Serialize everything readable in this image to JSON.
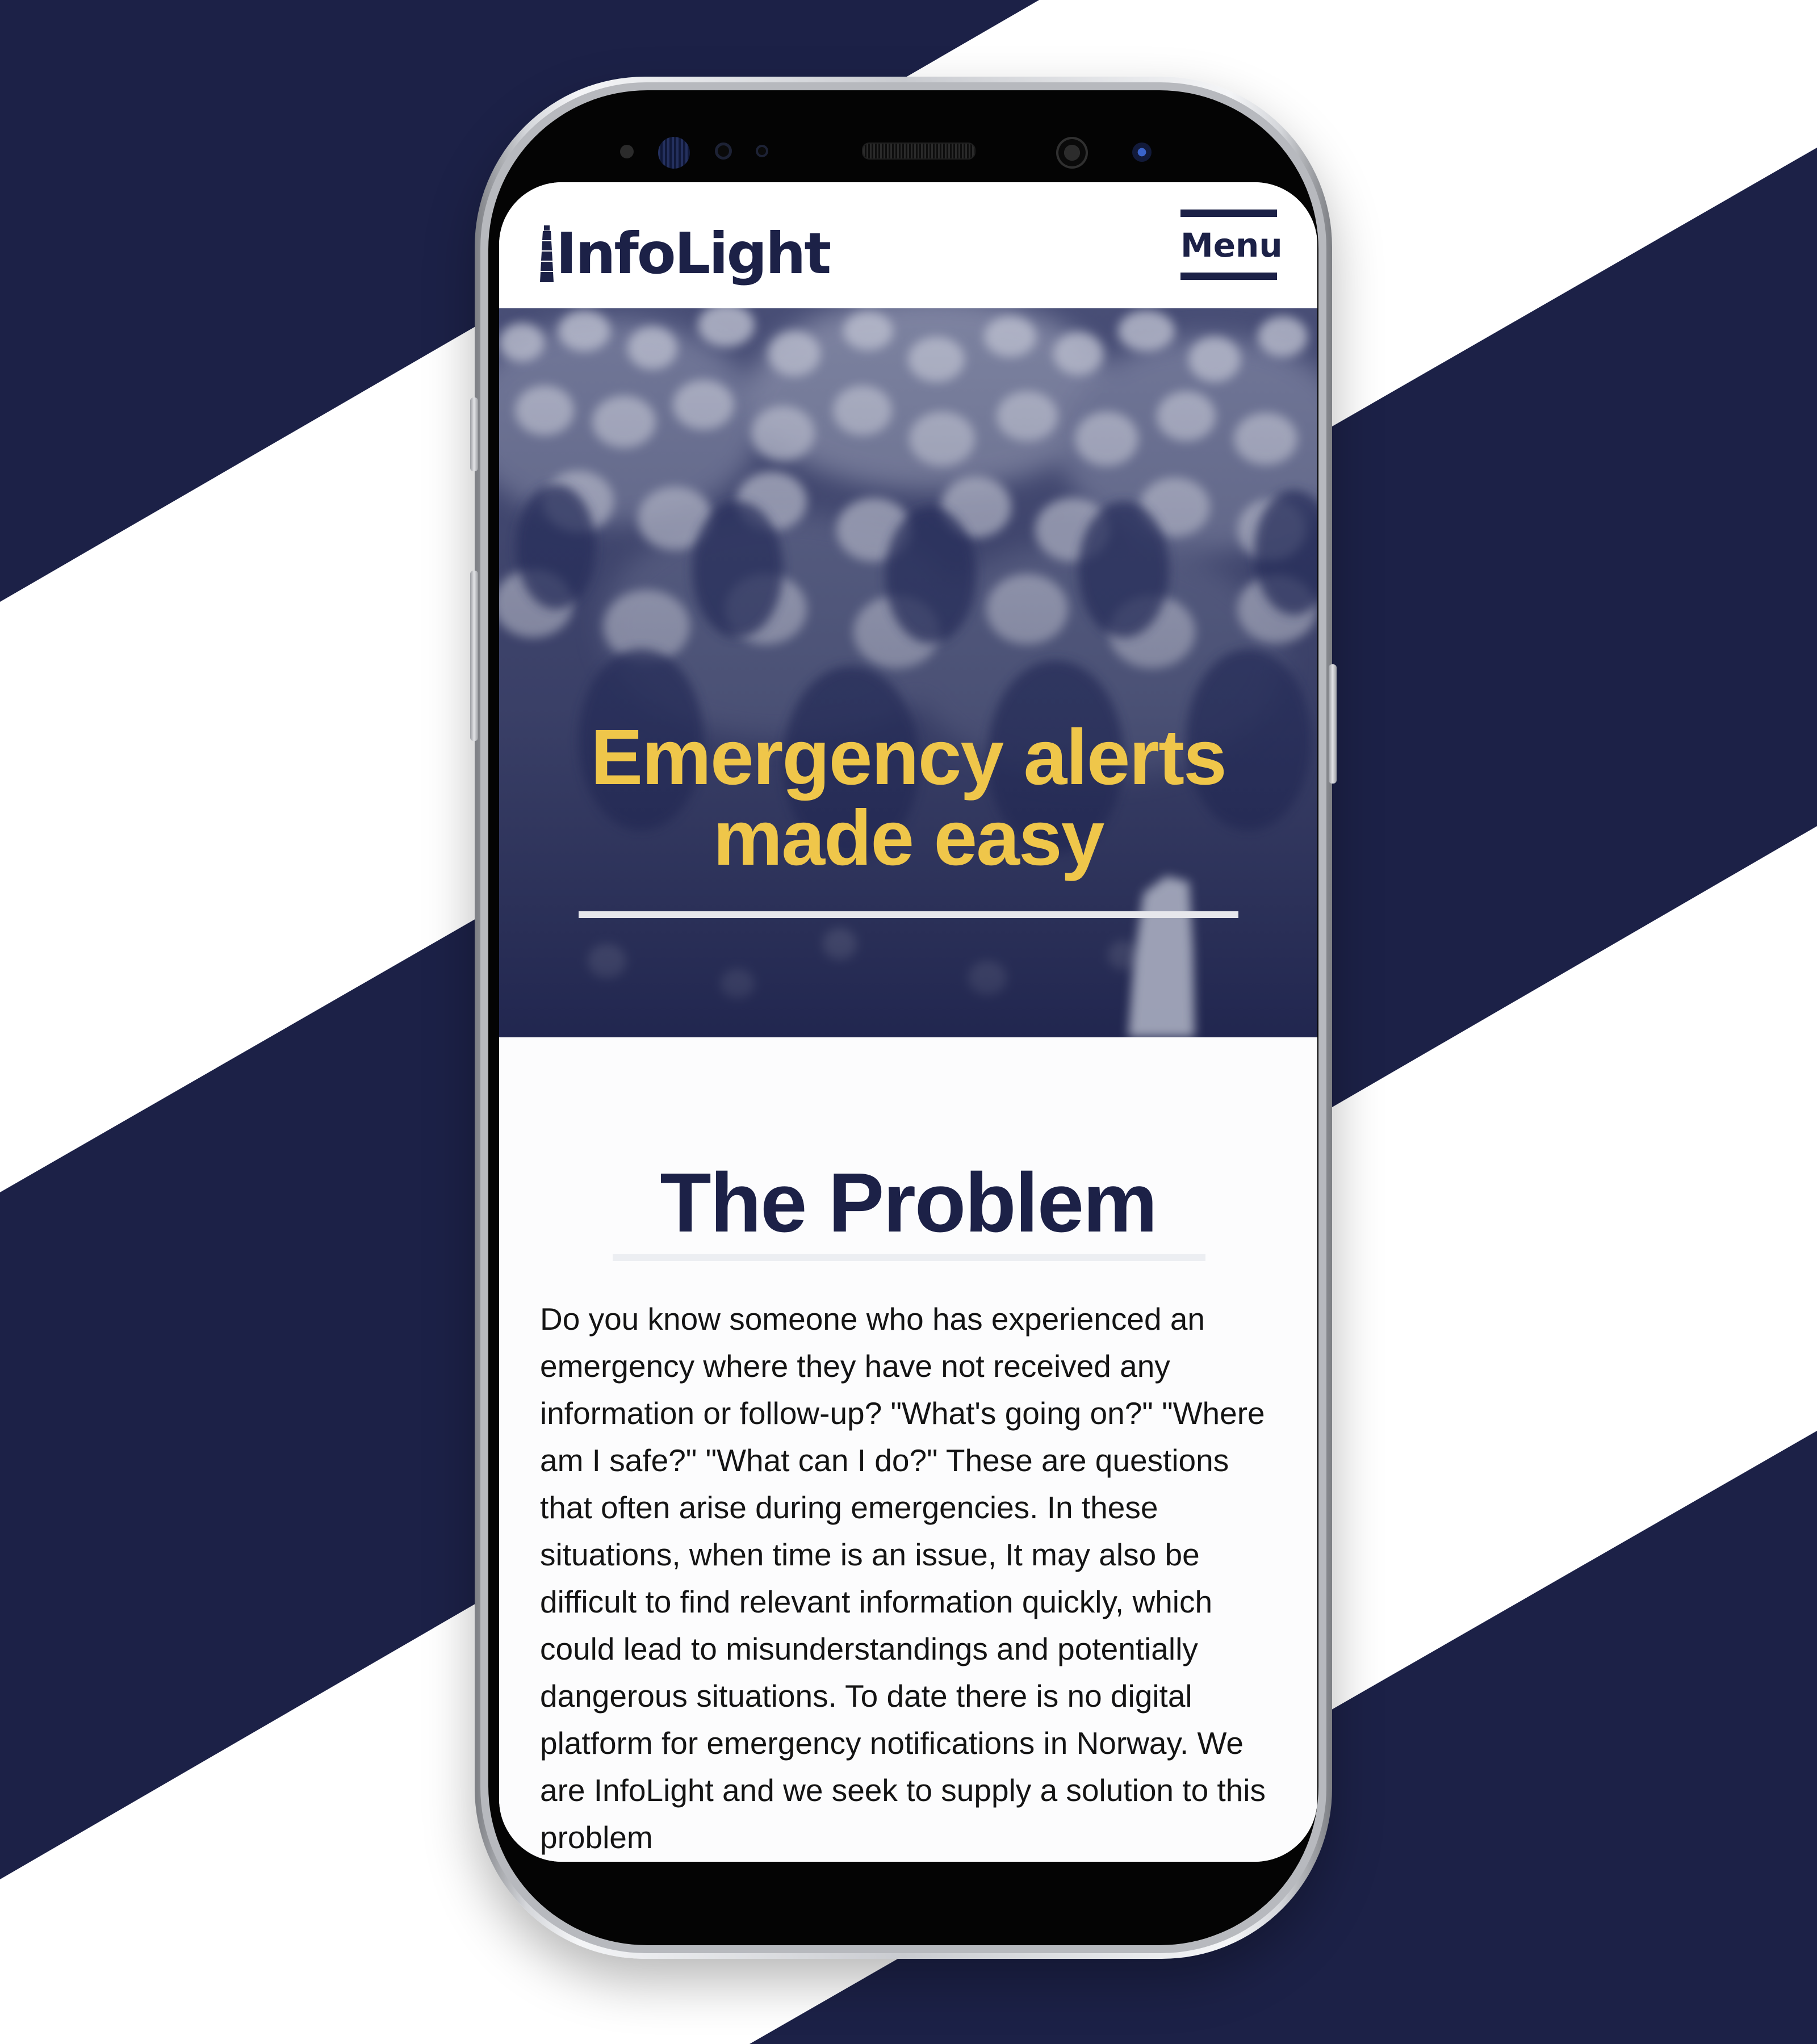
{
  "brand": {
    "name": "InfoLight"
  },
  "header": {
    "menu_label": "Menu"
  },
  "hero": {
    "title": "Emergency alerts made easy"
  },
  "problem": {
    "title": "The Problem",
    "body": "Do you know someone who has experienced an emergency where they have not received any information or follow-up? \"What's going on?\" \"Where am I safe?\" \"What can I do?\" These are questions that often arise during emergencies. In these situations, when time is an issue, It may also be difficult to find relevant information quickly, which could lead to misunderstandings and potentially dangerous situations. To date there is no digital platform for emergency notifications in Norway. We are InfoLight and we seek to supply a solution to this problem"
  },
  "colors": {
    "navy": "#1c2147",
    "accent_yellow": "#efc64a",
    "background_white": "#ffffff"
  },
  "icons": {
    "logo": "lighthouse-icon",
    "menu": "hamburger-menu-icon"
  }
}
